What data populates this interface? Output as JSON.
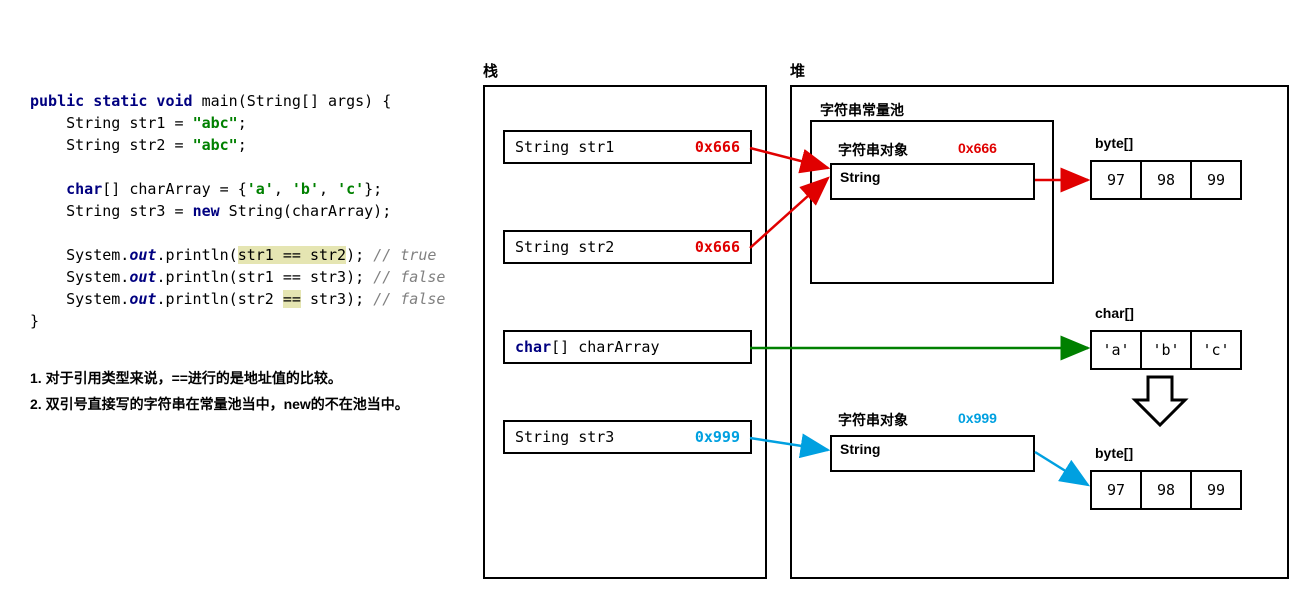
{
  "code": {
    "l1a": "public static void",
    "l1b": " main(String[] args) {",
    "l2a": "    String str1 = ",
    "l2b": "\"abc\"",
    "l2c": ";",
    "l3a": "    String str2 = ",
    "l3b": "\"abc\"",
    "l3c": ";",
    "l4": "",
    "l5a": "    ",
    "l5b": "char",
    "l5c": "[] charArray = {",
    "l5d": "'a'",
    "l5e": ", ",
    "l5f": "'b'",
    "l5g": ", ",
    "l5h": "'c'",
    "l5i": "};",
    "l6a": "    String str3 = ",
    "l6b": "new",
    "l6c": " String(charArray);",
    "l7": "",
    "l8a": "    System.",
    "l8b": "out",
    "l8c": ".println(",
    "l8d": "str1 == str2",
    "l8e": "); ",
    "l8f": "// true",
    "l9a": "    System.",
    "l9b": "out",
    "l9c": ".println(str1 == str3); ",
    "l9d": "// false",
    "l10a": "    System.",
    "l10b": "out",
    "l10c": ".println(str2 ",
    "l10d": "==",
    "l10e": " str3); ",
    "l10f": "// false",
    "l11": "}"
  },
  "notes": {
    "n1": "1. 对于引用类型来说，==进行的是地址值的比较。",
    "n2": "2. 双引号直接写的字符串在常量池当中，new的不在池当中。"
  },
  "headings": {
    "stack": "栈",
    "heap": "堆"
  },
  "stack": {
    "str1": "String str1",
    "str1addr": "0x666",
    "str2": "String str2",
    "str2addr": "0x666",
    "ca1": "char",
    "ca2": "[] charArray",
    "str3": "String str3",
    "str3addr": "0x999"
  },
  "heap": {
    "poolTitle": "字符串常量池",
    "obj1": "字符串对象",
    "addr1": "0x666",
    "obj2": "字符串对象",
    "addr2": "0x999",
    "stringLabel": "String",
    "byteLabel": "byte[]",
    "charLabel": "char[]",
    "bytes": [
      "97",
      "98",
      "99"
    ],
    "chars": [
      "'a'",
      "'b'",
      "'c'"
    ]
  }
}
